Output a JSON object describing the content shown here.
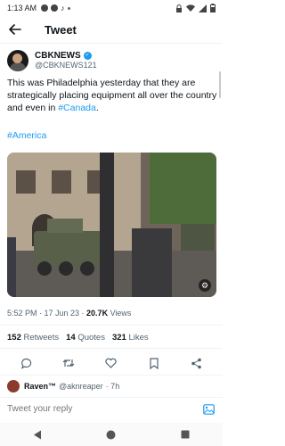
{
  "status_bar": {
    "time": "1:13 AM",
    "left_icons": [
      "messenger-icon",
      "messenger-icon",
      "tiktok-icon",
      "dot-icon"
    ],
    "right_icons": [
      "lock-icon",
      "wifi-icon",
      "signal-icon",
      "battery-icon"
    ]
  },
  "header": {
    "title": "Tweet",
    "back_icon": "arrow-left-icon"
  },
  "tweet": {
    "author": {
      "name": "CBKNEWS",
      "handle": "@CBKNEWS121",
      "verified": true
    },
    "text_before_link": "This was Philadelphia yesterday that they are strategically placing equipment all over the country and even in ",
    "link_text": "#Canada",
    "text_after_link": ".",
    "hashtag": "#America",
    "time": "5:52 PM · 17 Jun 23 · ",
    "views_count": "20.7K",
    "views_label": " Views",
    "stats": {
      "retweets_count": "152",
      "retweets_label": "Retweets",
      "quotes_count": "14",
      "quotes_label": "Quotes",
      "likes_count": "321",
      "likes_label": "Likes"
    },
    "actions": [
      "reply-icon",
      "retweet-icon",
      "like-icon",
      "bookmark-icon",
      "share-icon"
    ]
  },
  "reply_preview": {
    "name": "Raven™",
    "handle": "@aknreaper",
    "time": "· 7h"
  },
  "composer": {
    "placeholder": "Tweet your reply"
  },
  "colors": {
    "accent": "#1d9bf0",
    "text": "#0f1419",
    "secondary": "#536471"
  }
}
